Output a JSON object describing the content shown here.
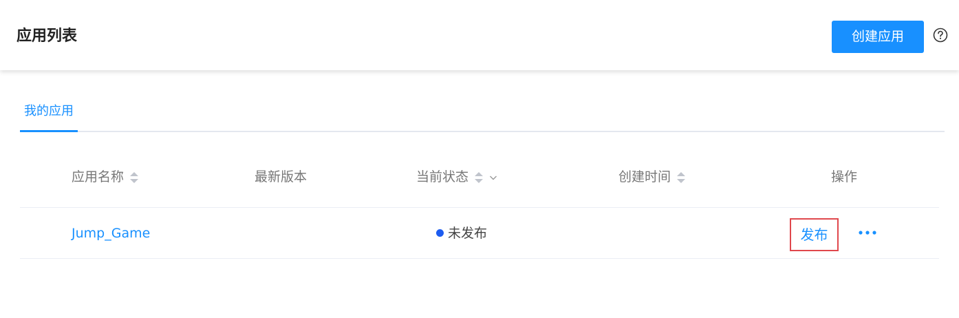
{
  "header": {
    "title": "应用列表",
    "create_button": "创建应用",
    "help_icon": "question-circle-icon"
  },
  "tabs": [
    {
      "label": "我的应用",
      "active": true
    }
  ],
  "table": {
    "columns": [
      {
        "label": "应用名称",
        "sortable": true
      },
      {
        "label": "最新版本",
        "sortable": false
      },
      {
        "label": "当前状态",
        "sortable": true,
        "filterable": true
      },
      {
        "label": "创建时间",
        "sortable": true
      },
      {
        "label": "操作",
        "sortable": false
      }
    ],
    "rows": [
      {
        "name": "Jump_Game",
        "version": "",
        "status": "未发布",
        "created": "",
        "action_publish": "发布",
        "action_more_icon": "ellipsis-icon"
      }
    ]
  },
  "colors": {
    "accent": "#1890ff",
    "status_dot": "#1d5cf0",
    "highlight_border": "#e0474c"
  }
}
